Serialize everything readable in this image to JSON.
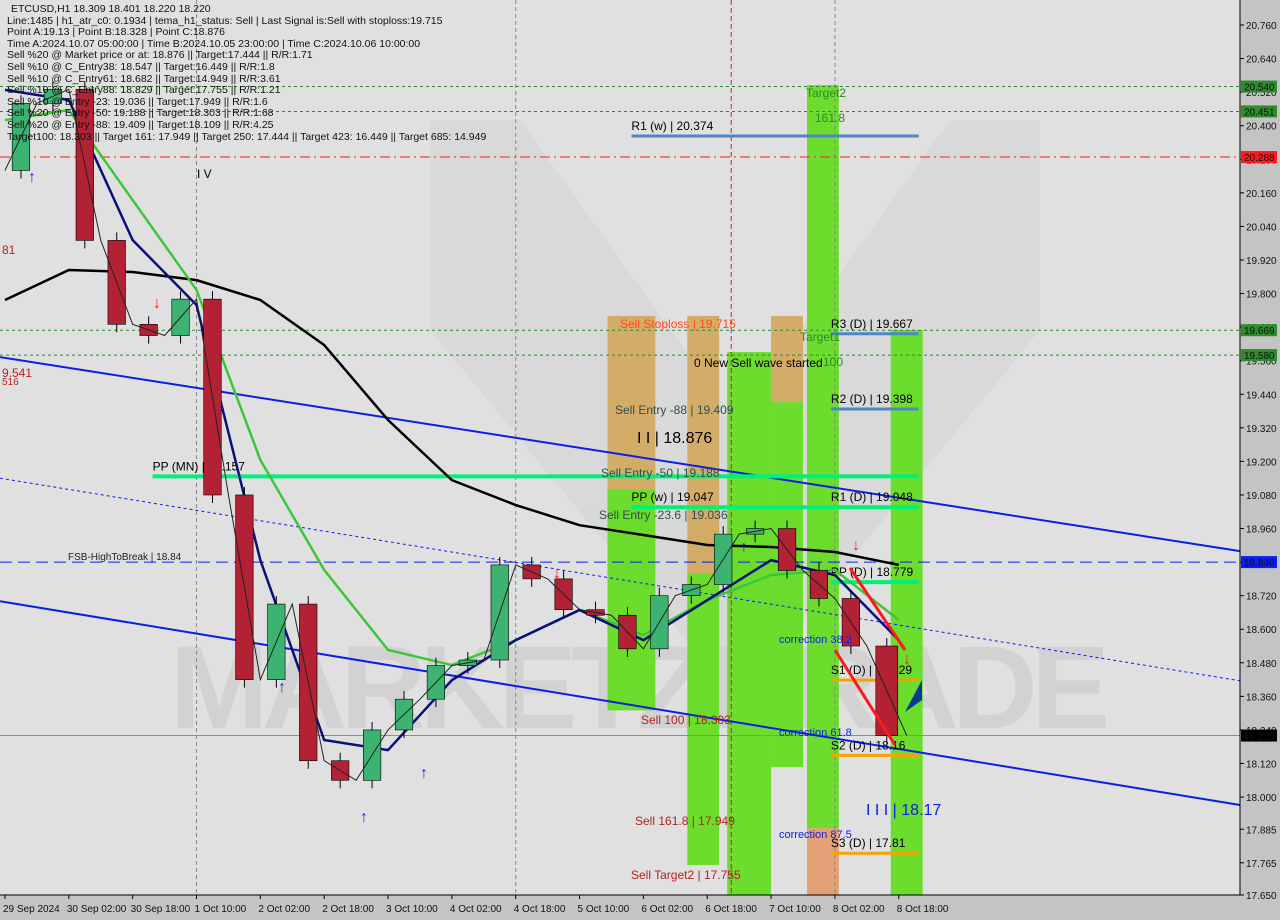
{
  "header": {
    "title": "ETCUSD,H1  18.309 18.401 18.220 18.220",
    "lines": [
      "Line:1485 | h1_atr_c0: 0.1934 | tema_h1_status: Sell | Last Signal is:Sell with stoploss:19.715",
      "Point A:19.13 | Point B:18.328 | Point C:18.876",
      "Time A:2024.10.07 05:00:00 | Time B:2024.10.05 23:00:00 | Time C:2024.10.06 10:00:00",
      "Sell %20 @ Market price or at: 18.876 || Target:17.444 || R/R:1.71",
      "Sell %10 @ C_Entry38: 18.547 || Target:16.449 || R/R:1.8",
      "Sell %10 @ C_Entry61: 18.682 || Target:14.949 || R/R:3.61",
      "Sell %10 @ C_Entry88: 18.829 || Target:17.755 || R/R:1.21",
      "Sell %10 @ Entry -23: 19.036 || Target:17.949 || R/R:1.6",
      "Sell %20 @ Entry -50: 19.188 || Target:18.303 || R/R:1.68",
      "Sell %20 @ Entry -88: 19.409 || Target:18.109 || R/R:4.25",
      "Target100: 18.303 || Target 161: 17.949 || Target 250: 17.444 || Target 423: 16.449 || Target 685: 14.949"
    ]
  },
  "colors": {
    "background": "#dedede",
    "axis": "#c4c4c4",
    "green_zone": "#5fdc1a",
    "tan_zone": "#d2a65a",
    "orange_zone": "#e59a6a",
    "pivot_green": "#00f07a",
    "pivot_blue": "#4f86c6",
    "pivot_orange": "#f5a300",
    "channel": "#0a1ee8",
    "ma_slow": "#000000",
    "ma_mid": "#3ec63a",
    "ma_fast": "#0b0f7a"
  },
  "chart_data": {
    "type": "line",
    "symbol": "ETCUSD",
    "timeframe": "H1",
    "ylim": [
      17.65,
      20.76
    ],
    "xlim": [
      "2024-09-29 09:00",
      "2024-10-11 06:00"
    ],
    "y_ticks": [
      "20.760",
      "20.640",
      "20.520",
      "20.400",
      "20.280",
      "20.160",
      "20.040",
      "19.920",
      "19.800",
      "19.680",
      "19.560",
      "19.440",
      "19.320",
      "19.200",
      "19.080",
      "18.960",
      "18.840",
      "18.720",
      "18.600",
      "18.480",
      "18.360",
      "18.240",
      "18.120",
      "18.000",
      "17.885",
      "17.765",
      "17.650"
    ],
    "x_ticks": [
      {
        "t": "2024-09-29 10:00",
        "label": "29 Sep 2024"
      },
      {
        "t": "2024-09-30 02:00",
        "label": "30 Sep 02:00"
      },
      {
        "t": "2024-09-30 18:00",
        "label": "30 Sep 18:00"
      },
      {
        "t": "2024-10-01 10:00",
        "label": "1 Oct 10:00"
      },
      {
        "t": "2024-10-02 02:00",
        "label": "2 Oct 02:00"
      },
      {
        "t": "2024-10-02 18:00",
        "label": "2 Oct 18:00"
      },
      {
        "t": "2024-10-03 10:00",
        "label": "3 Oct 10:00"
      },
      {
        "t": "2024-10-04 02:00",
        "label": "4 Oct 02:00"
      },
      {
        "t": "2024-10-04 18:00",
        "label": "4 Oct 18:00"
      },
      {
        "t": "2024-10-05 10:00",
        "label": "5 Oct 10:00"
      },
      {
        "t": "2024-10-06 02:00",
        "label": "6 Oct 02:00"
      },
      {
        "t": "2024-10-06 18:00",
        "label": "6 Oct 18:00"
      },
      {
        "t": "2024-10-07 10:00",
        "label": "7 Oct 10:00"
      },
      {
        "t": "2024-10-08 02:00",
        "label": "8 Oct 02:00"
      },
      {
        "t": "2024-10-08 18:00",
        "label": "8 Oct 18:00"
      }
    ],
    "price": {
      "t": [
        "2024-09-29 10:00",
        "2024-09-29 18:00",
        "2024-09-30 02:00",
        "2024-09-30 10:00",
        "2024-09-30 18:00",
        "2024-10-01 02:00",
        "2024-10-01 10:00",
        "2024-10-01 18:00",
        "2024-10-02 02:00",
        "2024-10-02 10:00",
        "2024-10-02 18:00",
        "2024-10-03 02:00",
        "2024-10-03 10:00",
        "2024-10-03 18:00",
        "2024-10-04 02:00",
        "2024-10-04 10:00",
        "2024-10-04 18:00",
        "2024-10-05 02:00",
        "2024-10-05 10:00",
        "2024-10-05 18:00",
        "2024-10-06 02:00",
        "2024-10-06 10:00",
        "2024-10-06 18:00",
        "2024-10-07 02:00",
        "2024-10-07 10:00",
        "2024-10-07 18:00",
        "2024-10-08 02:00",
        "2024-10-08 10:00",
        "2024-10-08 20:00"
      ],
      "close": [
        20.24,
        20.48,
        20.53,
        19.99,
        19.69,
        19.65,
        19.78,
        19.08,
        18.42,
        18.69,
        18.13,
        18.06,
        18.24,
        18.35,
        18.47,
        18.49,
        18.83,
        18.78,
        18.67,
        18.65,
        18.53,
        18.72,
        18.76,
        18.94,
        18.96,
        18.81,
        18.71,
        18.54,
        18.22
      ]
    },
    "moving_averages": {
      "t": [
        "2024-09-29 10:00",
        "2024-09-30 02:00",
        "2024-09-30 18:00",
        "2024-10-01 10:00",
        "2024-10-02 02:00",
        "2024-10-02 18:00",
        "2024-10-03 10:00",
        "2024-10-04 02:00",
        "2024-10-04 18:00",
        "2024-10-05 10:00",
        "2024-10-06 02:00",
        "2024-10-06 18:00",
        "2024-10-07 10:00",
        "2024-10-08 02:00",
        "2024-10-08 18:00"
      ],
      "slow": [
        19.777,
        19.884,
        19.877,
        19.848,
        19.777,
        19.616,
        19.348,
        19.133,
        19.044,
        18.972,
        18.937,
        18.901,
        18.894,
        18.876,
        18.83
      ],
      "mid": [
        20.42,
        20.456,
        20.134,
        19.813,
        19.205,
        18.812,
        18.526,
        18.472,
        18.561,
        18.669,
        18.579,
        18.704,
        18.794,
        18.812,
        18.633
      ],
      "fast": [
        20.528,
        20.492,
        19.991,
        19.759,
        18.847,
        18.204,
        18.168,
        18.418,
        18.561,
        18.669,
        18.561,
        18.704,
        18.847,
        18.794,
        18.561
      ]
    },
    "channel": [
      {
        "style": "solid",
        "from": [
          "2024-09-29 10:00",
          19.57
        ],
        "to": [
          "2024-10-08 18:00",
          19.07
        ]
      },
      {
        "style": "dotted",
        "from": [
          "2024-09-29 10:00",
          19.137
        ],
        "to": [
          "2024-10-08 18:00",
          18.615
        ]
      },
      {
        "style": "solid",
        "from": [
          "2024-09-29 10:00",
          18.697
        ],
        "to": [
          "2024-10-08 18:00",
          18.172
        ]
      }
    ],
    "horizontal_levels": [
      {
        "price": "20.540",
        "style": "green-dotted",
        "tag_color": "#2e8b2e"
      },
      {
        "price": "20.451",
        "style": "green-dotted",
        "tag_color": "#2e8b2e"
      },
      {
        "price": "20.288",
        "style": "red-dashdot",
        "tag_color": "#ff1a1a"
      },
      {
        "price": "19.669",
        "style": "green-dotted",
        "tag_color": "#2e8b2e"
      },
      {
        "price": "19.580",
        "style": "green-dotted",
        "tag_color": "#2e8b2e"
      },
      {
        "price": "18.840",
        "style": "blue-dashed",
        "tag_color": "#0a1ee8"
      },
      {
        "price": "18.220",
        "style": "grey-solid",
        "tag_color": "#000000"
      }
    ],
    "zones": [
      {
        "kind": "tan",
        "t0": "2024-10-05 17:00",
        "t1": "2024-10-06 05:00",
        "p0": 19.72,
        "p1": 19.1
      },
      {
        "kind": "green",
        "t0": "2024-10-05 17:00",
        "t1": "2024-10-06 05:00",
        "p0": 19.1,
        "p1": 18.31
      },
      {
        "kind": "tan",
        "t0": "2024-10-06 13:00",
        "t1": "2024-10-06 21:00",
        "p0": 19.72,
        "p1": 18.8
      },
      {
        "kind": "green",
        "t0": "2024-10-06 13:00",
        "t1": "2024-10-06 21:00",
        "p0": 18.8,
        "p1": 17.757
      },
      {
        "kind": "green",
        "t0": "2024-10-06 23:00",
        "t1": "2024-10-07 10:00",
        "p0": 19.591,
        "p1": 17.65
      },
      {
        "kind": "tan",
        "t0": "2024-10-07 10:00",
        "t1": "2024-10-07 18:00",
        "p0": 19.72,
        "p1": 19.412
      },
      {
        "kind": "green",
        "t0": "2024-10-07 10:00",
        "t1": "2024-10-07 18:00",
        "p0": 19.412,
        "p1": 18.107
      },
      {
        "kind": "green",
        "t0": "2024-10-07 19:00",
        "t1": "2024-10-08 03:00",
        "p0": 20.545,
        "p1": 17.889
      },
      {
        "kind": "orange",
        "t0": "2024-10-07 19:00",
        "t1": "2024-10-08 03:00",
        "p0": 17.889,
        "p1": 17.65
      },
      {
        "kind": "green",
        "t0": "2024-10-08 16:00",
        "t1": "2024-10-09 00:00",
        "p0": 19.67,
        "p1": 17.65
      }
    ],
    "pivots": [
      {
        "label": "R1 (w) | 20.374",
        "price": 20.374,
        "t0": "2024-10-05 23:00",
        "t1": "2024-10-08 23:00",
        "color": "pivot_blue"
      },
      {
        "label": "R3 (D) | 19.667",
        "price": 19.667,
        "t0": "2024-10-08 01:00",
        "t1": "2024-10-08 23:00",
        "color": "pivot_blue"
      },
      {
        "label": "R2 (D) | 19.398",
        "price": 19.398,
        "t0": "2024-10-08 01:00",
        "t1": "2024-10-08 23:00",
        "color": "pivot_blue"
      },
      {
        "label": "PP (MN) | 19.157",
        "price": 19.157,
        "t0": "2024-09-30 23:00",
        "t1": "2024-10-08 23:00",
        "color": "pivot_green"
      },
      {
        "label": "PP (w) | 19.047",
        "price": 19.047,
        "t0": "2024-10-05 23:00",
        "t1": "2024-10-08 23:00",
        "color": "pivot_green"
      },
      {
        "label": "R1 (D) | 19.048",
        "price": 19.048,
        "t0": "2024-10-08 01:00",
        "t1": "2024-10-08 23:00",
        "color": "none"
      },
      {
        "label": "PP (D) | 18.779",
        "price": 18.779,
        "t0": "2024-10-08 01:00",
        "t1": "2024-10-08 23:00",
        "color": "pivot_green"
      },
      {
        "label": "S1 (D) | 18.429",
        "price": 18.429,
        "t0": "2024-10-08 01:00",
        "t1": "2024-10-08 23:00",
        "color": "pivot_orange"
      },
      {
        "label": "S2 (D) | 18.16",
        "price": 18.16,
        "t0": "2024-10-08 01:00",
        "t1": "2024-10-08 23:00",
        "color": "pivot_orange"
      },
      {
        "label": "S3 (D) | 17.81",
        "price": 17.81,
        "t0": "2024-10-08 01:00",
        "t1": "2024-10-08 23:00",
        "color": "pivot_orange"
      }
    ],
    "annotations": {
      "sell_stoploss": "Sell Stoploss | 19.715",
      "target1": "Target1",
      "target1_pct": "100",
      "target2": "Target2",
      "target2_pct": "161.8",
      "new_wave": "0 New Sell wave started",
      "sell_entry_88": "Sell Entry -88 | 19.409",
      "sell_entry_50": "Sell Entry -50 | 19.188",
      "sell_entry_23": "Sell Entry -23.6 | 19.036",
      "wave_c": "I I | 18.876",
      "wave_iii": "I I I | 18.17",
      "wave_iv": "I V",
      "sell_100": "Sell 100 | 18.303",
      "sell_161": "Sell 161.8 | 17.949",
      "sell_target2": "Sell Target2 | 17.755",
      "correction_382": "correction 38.2",
      "correction_618": "correction 61.8",
      "correction_875": "correction 87.5",
      "fsb": "FSB-HighToBreak | 18.84",
      "left_81": "81",
      "left_9541": "9.541",
      "left_516": "516",
      "watermark": "MARKETZITRADE"
    }
  }
}
